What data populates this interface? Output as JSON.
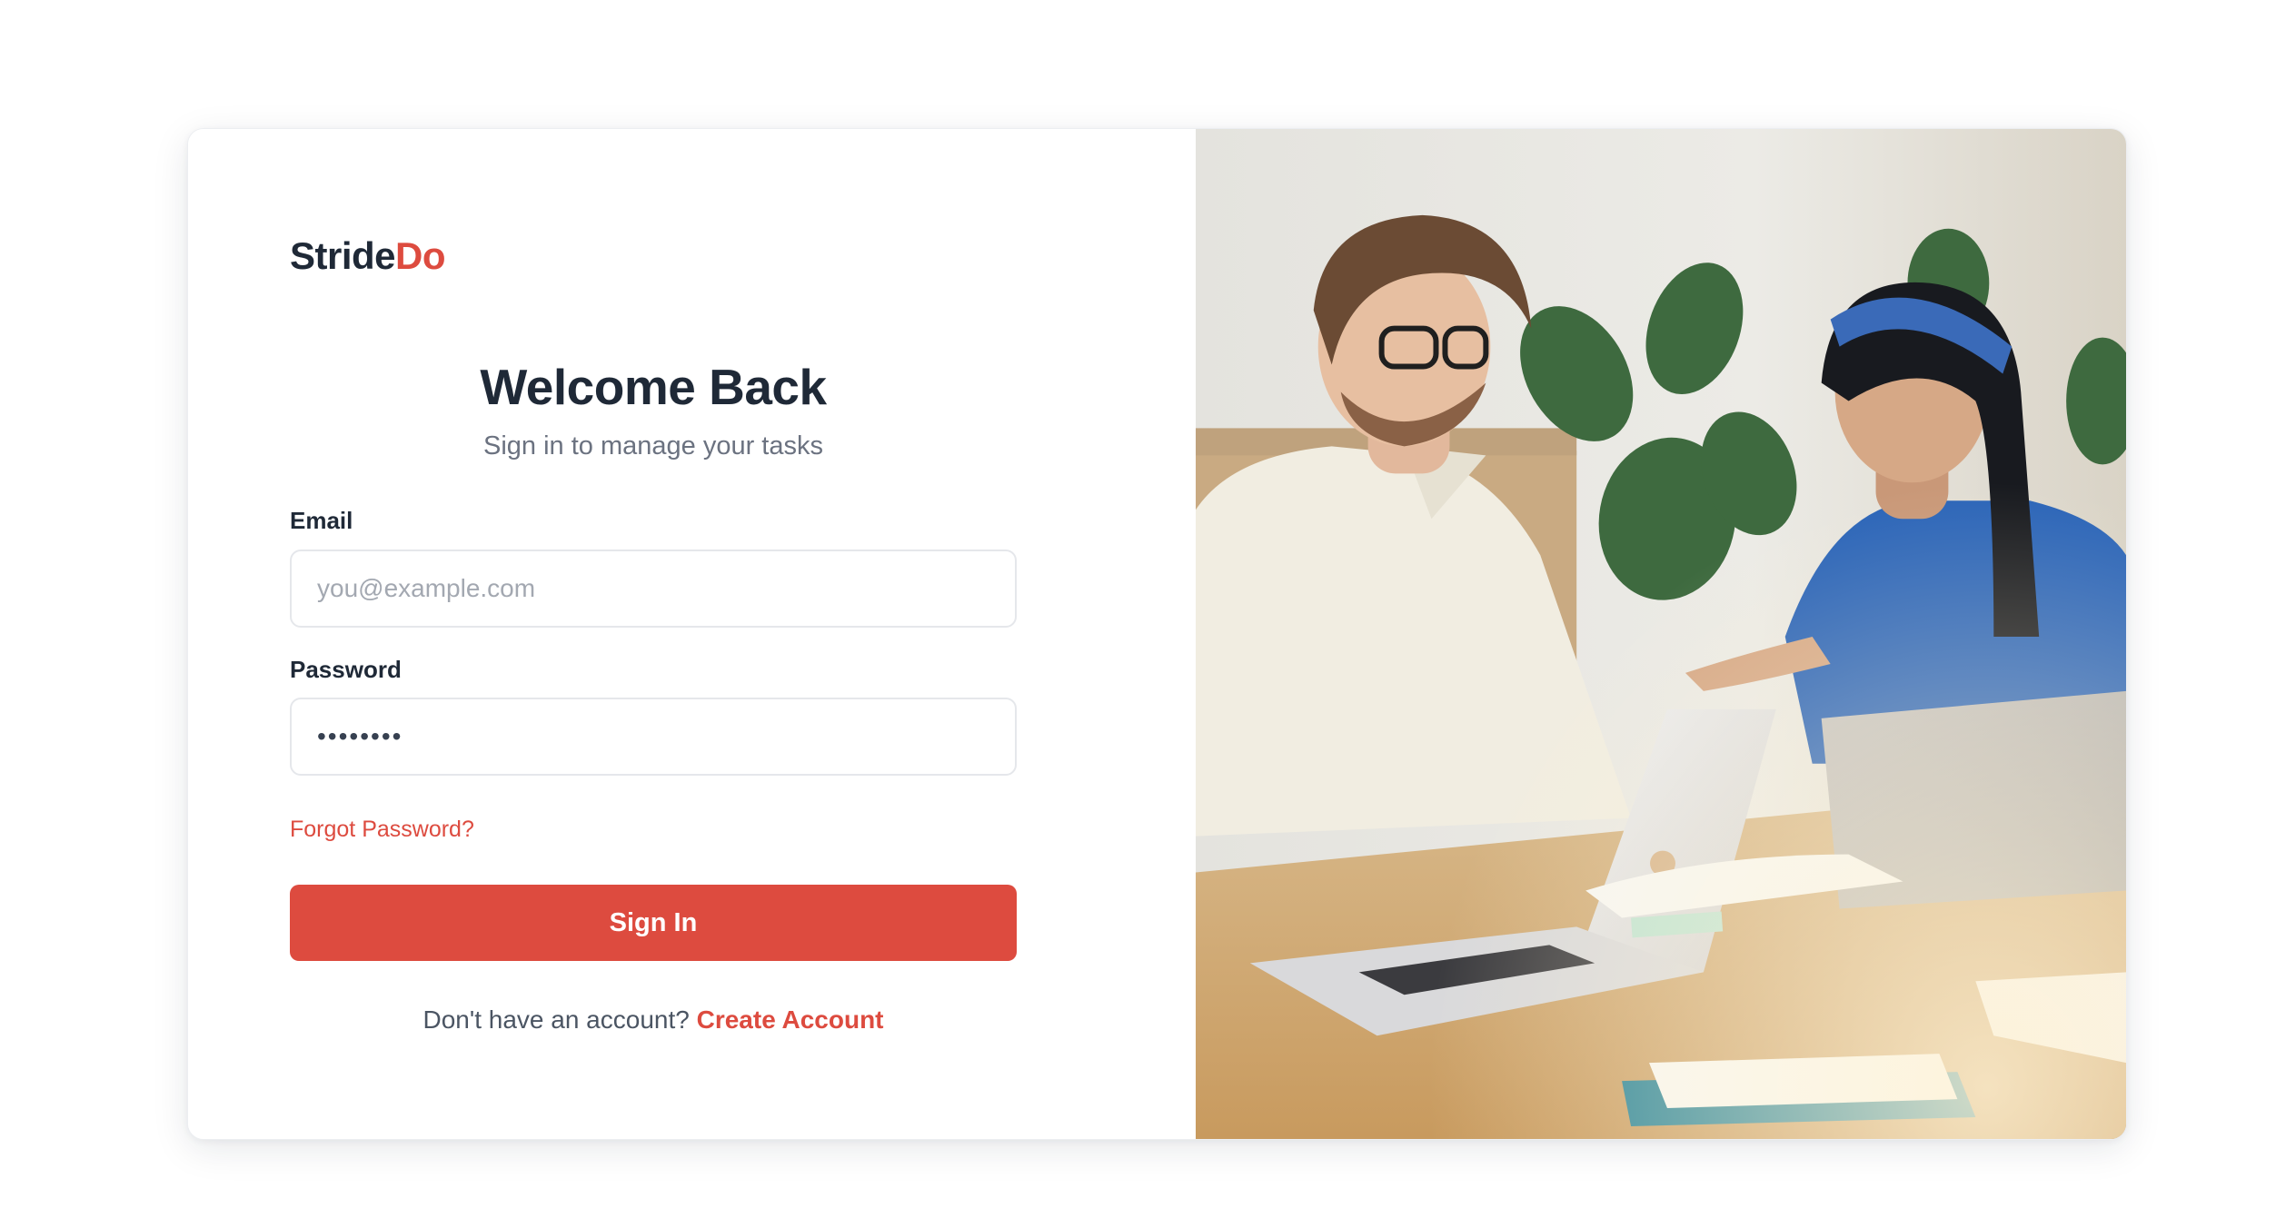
{
  "brand": {
    "name_part1": "Stride",
    "name_part2": "Do"
  },
  "header": {
    "title": "Welcome Back",
    "subtitle": "Sign in to manage your tasks"
  },
  "form": {
    "email": {
      "label": "Email",
      "placeholder": "you@example.com",
      "value": ""
    },
    "password": {
      "label": "Password",
      "value": "••••••••"
    },
    "forgot_label": "Forgot Password?",
    "submit_label": "Sign In"
  },
  "footer": {
    "prompt": "Don't have an account?",
    "link_label": "Create Account"
  },
  "hero_image": {
    "description_icon": "team-collaboration-photo"
  },
  "colors": {
    "accent": "#dd4b3f",
    "heading": "#1f2937",
    "muted": "#6b7280"
  }
}
